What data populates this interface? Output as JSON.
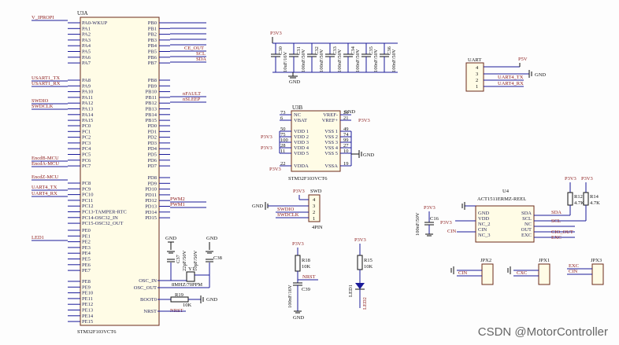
{
  "watermark": "CSDN @MotorController",
  "mcu": {
    "ref": "U3A",
    "part": "STM32F103VCT6",
    "left_pins": [
      "PA0-WKUP",
      "PA1",
      "PA2",
      "PA3",
      "PA4",
      "PA5",
      "PA6",
      "PA7",
      "PA8",
      "PA9",
      "PA10",
      "PA11",
      "PA12",
      "PA13",
      "PA14",
      "PA15",
      "PC0",
      "PC1",
      "PC2",
      "PC3",
      "PC4",
      "PC5",
      "PC6",
      "PC7",
      "PC8",
      "PC9",
      "PC10",
      "PC11",
      "PC12",
      "PC13-TAMPER-RTC",
      "PC14-OSC32_IN",
      "PC15-OSC32_OUT",
      "PE0",
      "PE1",
      "PE2",
      "PE3",
      "PE4",
      "PE5",
      "PE6",
      "PE7",
      "PE8",
      "PE9",
      "PE10",
      "PE11",
      "PE12",
      "PE13",
      "PE14",
      "PE15"
    ],
    "right_pins": [
      "PB0",
      "PB1",
      "PB2",
      "PB3",
      "PB4",
      "PB5",
      "PB6",
      "PB7",
      "PB8",
      "PB9",
      "PB10",
      "PB11",
      "PB12",
      "PB13",
      "PB14",
      "PB15",
      "PD0",
      "PD1",
      "PD2",
      "PD3",
      "PD4",
      "PD5",
      "PD6",
      "PD7",
      "PD8",
      "PD9",
      "PD10",
      "PD11",
      "PD12",
      "PD13",
      "PD14",
      "PD15"
    ],
    "osc_pins": [
      "OSC_IN",
      "OSC_OUT",
      "BOOT0",
      "NRST"
    ]
  },
  "nets": {
    "left": [
      "V_IPROPI",
      "USART1_TX",
      "USART1_RX",
      "SWDIO",
      "SWDCLK",
      "EncdB-MCU",
      "EncdA-MCU",
      "EncdZ-MCU",
      "UART4_TX",
      "UART4_RX",
      "LED1"
    ],
    "right": [
      "CE_OUT",
      "SCL",
      "SDA",
      "nFAULT",
      "nSLEEP",
      "PWM2",
      "PWM1"
    ]
  },
  "power": {
    "p3v3": "P3V3",
    "p5v": "P5V",
    "gnd": "GND",
    "caps": [
      "C30",
      "C31",
      "C32",
      "C33",
      "C34",
      "C35",
      "C36"
    ],
    "cap_values": [
      "10uF/16V",
      "100nF/50V",
      "100nF/50V",
      "100nF/50V",
      "100nF/50V",
      "100nF/50V",
      "100nF/50V"
    ]
  },
  "u3b": {
    "ref": "U3B",
    "part": "STM32F103VCT6",
    "left": [
      "NC",
      "VBAT",
      "VDD_1",
      "VDD_2",
      "VDD_3",
      "VDD_4",
      "VDD_5",
      "VDDA"
    ],
    "right": [
      "VREF-",
      "VREF+",
      "VSS_1",
      "VSS_2",
      "VSS_3",
      "VSS_4",
      "VSS_5",
      "VSSA"
    ],
    "left_nums": [
      "73",
      "6",
      "50",
      "75",
      "100",
      "28",
      "11",
      "22"
    ],
    "right_nums": [
      "20",
      "21",
      "49",
      "74",
      "99",
      "27",
      "10",
      "19"
    ]
  },
  "uart": {
    "title": "UART",
    "pins": [
      "4",
      "3",
      "2",
      "1"
    ],
    "nets": [
      "P5V",
      "UART4_TX",
      "UART4_RX",
      "GND"
    ]
  },
  "swd": {
    "title": "SWD",
    "ref": "4PIN",
    "pins": [
      "4",
      "3",
      "2",
      "1"
    ],
    "nets": [
      "P3V3",
      "GND",
      "SWDIO",
      "SWDCLK"
    ]
  },
  "osc": {
    "crystal": "Y1",
    "crystal_val": "8MHZ/70PPM",
    "c37": "C37",
    "c38": "C38",
    "c37_val": "22pF/50V",
    "c38_val": "10pF/50V",
    "r19": "R19",
    "r19_val": "10K",
    "nrst": "NRST"
  },
  "rst": {
    "r18": "R18",
    "r18_val": "10K",
    "c39": "C39",
    "c39_val": "100nF/16V",
    "net": "NRST"
  },
  "led": {
    "r15": "R15",
    "r15_val": "10K",
    "d": "LED1",
    "net": "LED2"
  },
  "u4": {
    "ref": "U4",
    "part": "ACT1511ERMZ-REEL",
    "left": [
      "GND",
      "VDD",
      "NC_2",
      "CIN",
      "NC_3"
    ],
    "right": [
      "SDA",
      "SCL",
      "NC",
      "OUT",
      "EXC"
    ],
    "cap": "C16",
    "cap_val": "100nF/50V",
    "r12": "R12",
    "r12_val": "4.7K",
    "r14": "R14",
    "r14_val": "4.7K",
    "nets_right": [
      "SDA",
      "SCL",
      "CIO_OUT",
      "EXC"
    ],
    "cin": "CIN"
  },
  "headers": [
    {
      "ref": "JPX2",
      "net": "CIN"
    },
    {
      "ref": "JPX1",
      "net": "CXC"
    },
    {
      "ref": "JPX3",
      "net": "EXC",
      "net2": "CIN"
    }
  ]
}
